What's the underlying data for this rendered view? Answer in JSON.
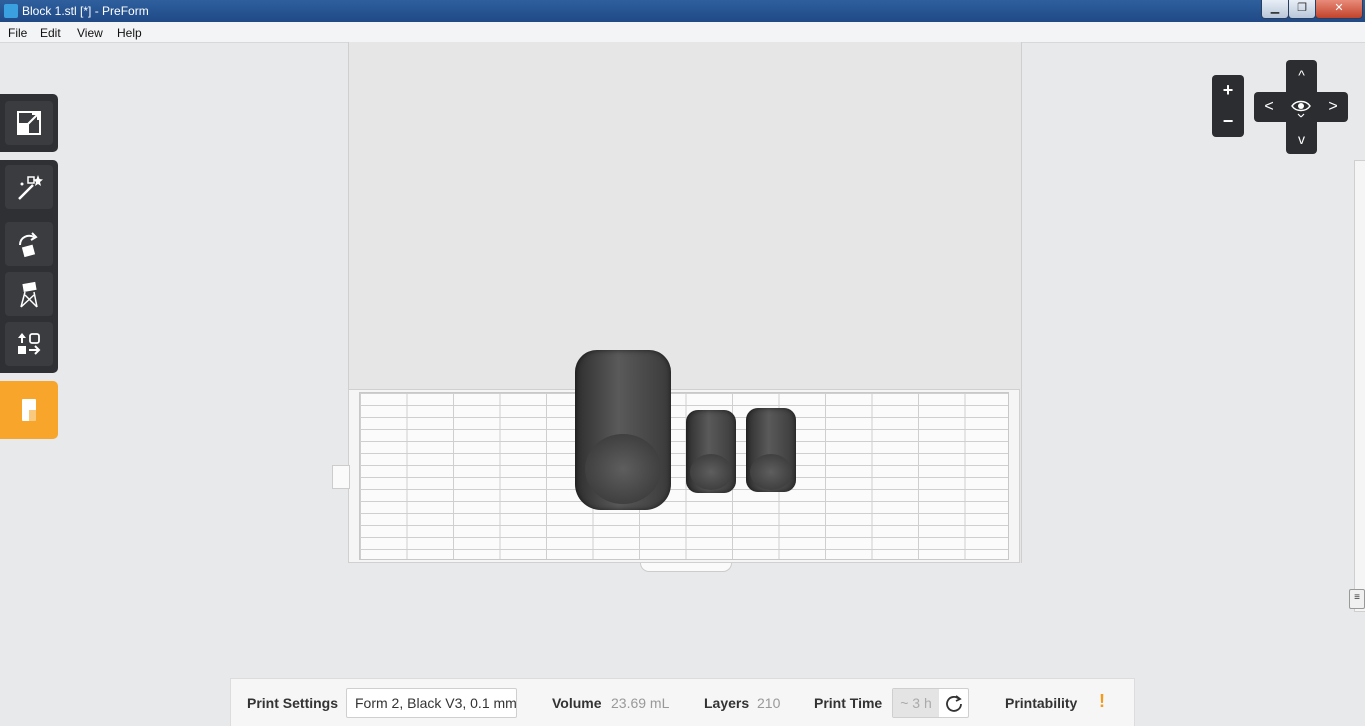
{
  "window": {
    "title": "Block 1.stl [*] - PreForm",
    "minimize_glyph": "▁",
    "maximize_glyph": "❐",
    "close_glyph": "✕"
  },
  "menu": [
    "File",
    "Edit",
    "View",
    "Help"
  ],
  "toolbar": {
    "tools": [
      {
        "name": "scale-view-icon"
      },
      {
        "name": "magic-wand-icon"
      },
      {
        "name": "orientation-icon"
      },
      {
        "name": "supports-icon"
      },
      {
        "name": "layout-icon"
      },
      {
        "name": "print-icon"
      }
    ]
  },
  "navigation": {
    "zoom_in": "+",
    "zoom_out": "−",
    "up": "^",
    "down": "v",
    "left": "<",
    "right": ">"
  },
  "status": {
    "print_settings_label": "Print Settings",
    "print_settings_value": "Form 2, Black V3, 0.1 mm",
    "volume_label": "Volume",
    "volume_value": "23.69 mL",
    "layers_label": "Layers",
    "layers_value": "210",
    "print_time_label": "Print Time",
    "print_time_value": "~ 3 h",
    "printability_label": "Printability",
    "printability_value": "!"
  },
  "colors": {
    "accent": "#f7a52b",
    "toolbar_bg": "#2f3033",
    "warning": "#f29a1a"
  }
}
